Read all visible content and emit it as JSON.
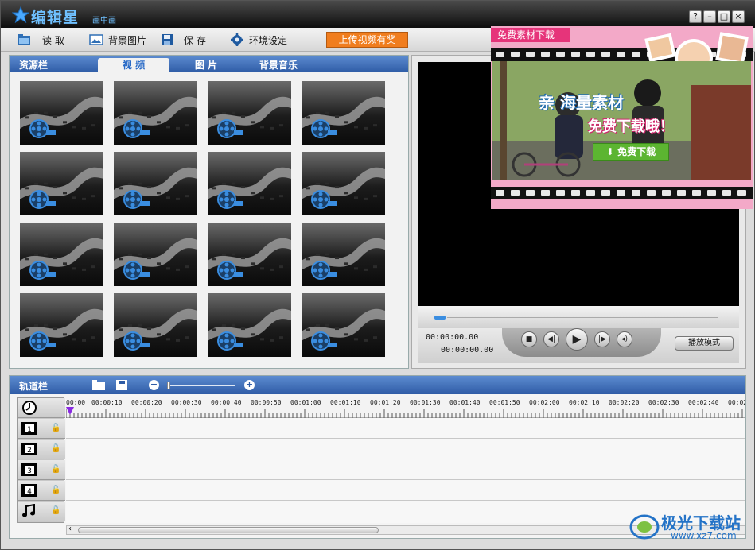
{
  "titlebar": {
    "title": "编辑星",
    "subtitle": "画中画",
    "buttons": [
      "?",
      "–",
      "□",
      "×"
    ]
  },
  "toolbar": {
    "open_label": "读 取",
    "bg_image_label": "背景图片",
    "save_label": "保 存",
    "settings_label": "环境设定",
    "upload_label": "上传视频有奖"
  },
  "resource": {
    "title": "资源栏",
    "tabs": [
      "视 频",
      "图 片",
      "背景音乐"
    ],
    "active_tab": 0,
    "thumbnail_count": 16
  },
  "player": {
    "time_current": "00:00:00.00",
    "time_total": "00:00:00.00",
    "mode_label": "播放模式",
    "progress": 0.0
  },
  "ad": {
    "tag": "免费素材下载",
    "headline1": "亲 海量素材",
    "headline2": "免费下载哦！",
    "button": "免费下载"
  },
  "tracks": {
    "title": "轨道栏",
    "rows": [
      "clock",
      "1",
      "2",
      "3",
      "4",
      "music"
    ],
    "ruler_labels": [
      "00:00",
      "00:00:10",
      "00:00:20",
      "00:00:30",
      "00:00:40",
      "00:00:50",
      "00:01:00",
      "00:01:10",
      "00:01:20",
      "00:01:30",
      "00:01:40",
      "00:01:50",
      "00:02:00",
      "00:02:10",
      "00:02:20",
      "00:02:30",
      "00:02:40",
      "00:02"
    ],
    "zoom": 0.0
  },
  "watermark": {
    "text1": "极光下载站",
    "text2": "www.xz7.com"
  },
  "colors": {
    "titlebar": "#0e0e0e",
    "panel_header": "#2f5ca6",
    "accent_blue": "#6fc0ff",
    "upload_orange": "#f07d1e",
    "ad_pink": "#f3a9c8",
    "ad_tag": "#e6347a",
    "ad_button": "#5cb531"
  }
}
